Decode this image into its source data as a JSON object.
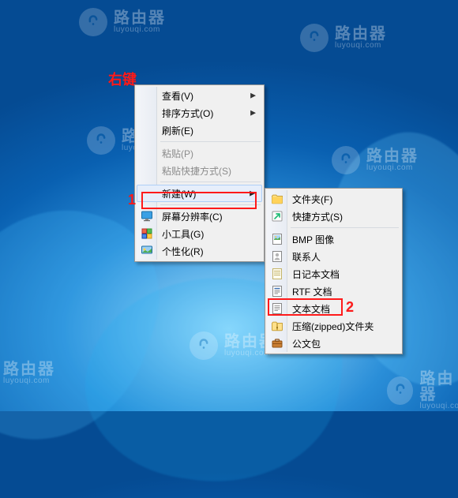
{
  "watermark": {
    "brand": "路由器",
    "domain": "luyouqi.com"
  },
  "annotations": {
    "right_click_label": "右键",
    "marker1": "1",
    "marker2": "2"
  },
  "main_menu": {
    "items": [
      {
        "label": "查看(V)",
        "has_submenu": true
      },
      {
        "label": "排序方式(O)",
        "has_submenu": true
      },
      {
        "label": "刷新(E)"
      }
    ],
    "items2": [
      {
        "label": "粘贴(P)",
        "disabled": true
      },
      {
        "label": "粘贴快捷方式(S)",
        "disabled": true
      }
    ],
    "items3": [
      {
        "label": "新建(W)",
        "has_submenu": true,
        "highlight": true
      }
    ],
    "items4": [
      {
        "label": "屏幕分辨率(C)",
        "icon": "monitor"
      },
      {
        "label": "小工具(G)",
        "icon": "gadget"
      },
      {
        "label": "个性化(R)",
        "icon": "personalize"
      }
    ]
  },
  "sub_menu": {
    "items_top": [
      {
        "label": "文件夹(F)",
        "icon": "folder"
      },
      {
        "label": "快捷方式(S)",
        "icon": "shortcut"
      }
    ],
    "items_mid": [
      {
        "label": "BMP 图像",
        "icon": "bmp"
      },
      {
        "label": "联系人",
        "icon": "contact"
      },
      {
        "label": "日记本文档",
        "icon": "journal"
      },
      {
        "label": "RTF 文档",
        "icon": "rtf"
      },
      {
        "label": "文本文档",
        "icon": "txt",
        "marked": true
      },
      {
        "label": "压缩(zipped)文件夹",
        "icon": "zip"
      },
      {
        "label": "公文包",
        "icon": "briefcase"
      }
    ]
  }
}
